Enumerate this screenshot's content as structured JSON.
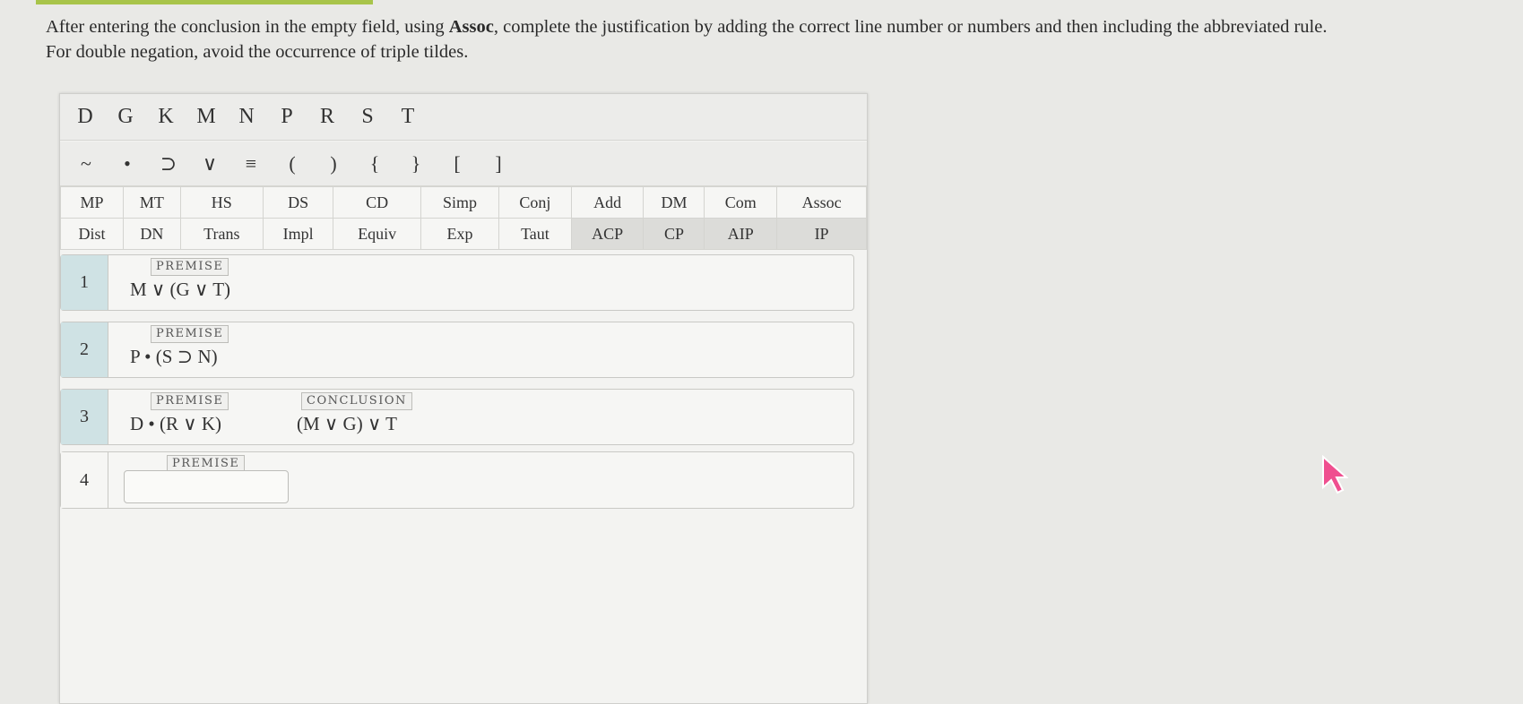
{
  "instructions": {
    "part1": "After entering the conclusion in the empty field, using ",
    "bold": "Assoc",
    "part2": ", complete the justification by adding the correct line number or numbers and then including the abbreviated rule.",
    "line2": "For double negation, avoid the occurrence of triple tildes."
  },
  "letters": [
    "D",
    "G",
    "K",
    "M",
    "N",
    "P",
    "R",
    "S",
    "T"
  ],
  "symbols": [
    "~",
    "•",
    "⊃",
    "∨",
    "≡",
    "(",
    ")",
    "{",
    "}",
    "[",
    "]"
  ],
  "rules_row1": [
    "MP",
    "MT",
    "HS",
    "DS",
    "CD",
    "Simp",
    "Conj",
    "Add",
    "DM",
    "Com",
    "Assoc"
  ],
  "rules_row2": [
    "Dist",
    "DN",
    "Trans",
    "Impl",
    "Equiv",
    "Exp",
    "Taut",
    "ACP",
    "CP",
    "AIP",
    "IP"
  ],
  "lines": [
    {
      "num": "1",
      "tag": "PREMISE",
      "formula": "M ∨ (G ∨ T)"
    },
    {
      "num": "2",
      "tag": "PREMISE",
      "formula": "P • (S ⊃ N)"
    },
    {
      "num": "3",
      "tag": "PREMISE",
      "formula": "D • (R ∨ K)",
      "conclusion_tag": "CONCLUSION",
      "conclusion": "(M ∨ G) ∨ T"
    },
    {
      "num": "4",
      "tag": "PREMISE",
      "value": ""
    }
  ],
  "colors": {
    "accent_bar": "#a8c44a",
    "line_num_bg": "#cfe2e4",
    "cursor": "#ef4f8f"
  }
}
